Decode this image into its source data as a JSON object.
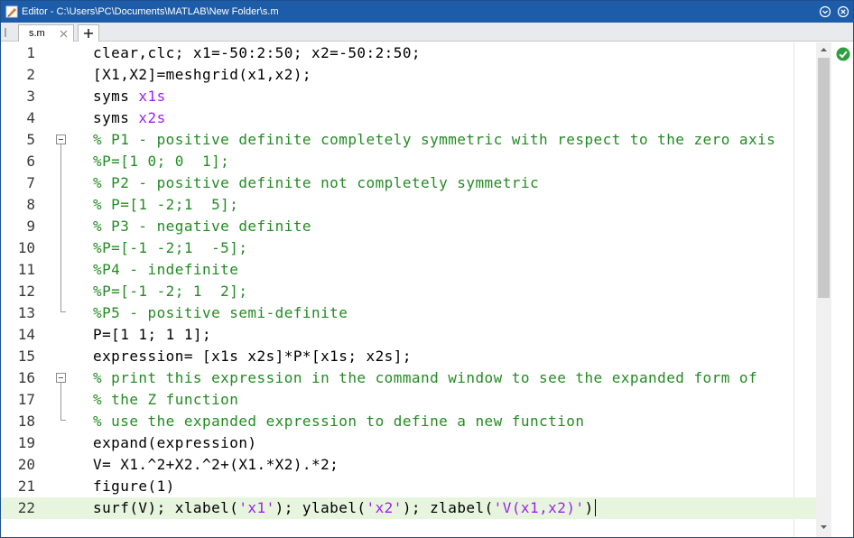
{
  "window": {
    "title": "Editor - C:\\Users\\PC\\Documents\\MATLAB\\New Folder\\s.m",
    "app_icon": "matlab-editor-icon",
    "controls": [
      "expand-icon",
      "close-icon"
    ]
  },
  "tabs": [
    {
      "label": "s.m",
      "active": true
    }
  ],
  "add_tab_icon": "plus-icon",
  "editor": {
    "current_line": 22,
    "status": "no-issues",
    "colors": {
      "comment": "#228b22",
      "symbol": "#a020f0",
      "string": "#a020f0",
      "current_line_bg": "#e7f5df",
      "title_bar": "#1d5ca8",
      "status_ok": "#2e9e3e"
    },
    "lines": [
      {
        "n": "1",
        "parts": [
          {
            "t": "clear,clc; x1=-50:2:50; x2=-50:2:50;",
            "c": "code"
          }
        ]
      },
      {
        "n": "2",
        "parts": [
          {
            "t": "[X1,X2]=meshgrid(x1,x2);",
            "c": "code"
          }
        ]
      },
      {
        "n": "3",
        "parts": [
          {
            "t": "syms ",
            "c": "code"
          },
          {
            "t": "x1s",
            "c": "sym"
          }
        ]
      },
      {
        "n": "4",
        "parts": [
          {
            "t": "syms ",
            "c": "code"
          },
          {
            "t": "x2s",
            "c": "sym"
          }
        ]
      },
      {
        "n": "5",
        "parts": [
          {
            "t": "% P1 - positive definite completely symmetric with respect to the zero axis",
            "c": "com"
          }
        ]
      },
      {
        "n": "6",
        "parts": [
          {
            "t": "%P=[1 0; 0  1];",
            "c": "com"
          }
        ]
      },
      {
        "n": "7",
        "parts": [
          {
            "t": "% P2 - positive definite not completely symmetric",
            "c": "com"
          }
        ]
      },
      {
        "n": "8",
        "parts": [
          {
            "t": "% P=[1 -2;1  5];",
            "c": "com"
          }
        ]
      },
      {
        "n": "9",
        "parts": [
          {
            "t": "% P3 - negative definite",
            "c": "com"
          }
        ]
      },
      {
        "n": "10",
        "parts": [
          {
            "t": "%P=[-1 -2;1  -5];",
            "c": "com"
          }
        ]
      },
      {
        "n": "11",
        "parts": [
          {
            "t": "%P4 - indefinite",
            "c": "com"
          }
        ]
      },
      {
        "n": "12",
        "parts": [
          {
            "t": "%P=[-1 -2; 1  2];",
            "c": "com"
          }
        ]
      },
      {
        "n": "13",
        "parts": [
          {
            "t": "%P5 - positive semi-definite",
            "c": "com"
          }
        ]
      },
      {
        "n": "14",
        "parts": [
          {
            "t": "P=[1 1; 1 1];",
            "c": "code"
          }
        ]
      },
      {
        "n": "15",
        "parts": [
          {
            "t": "expression= [x1s x2s]*P*[x1s; x2s];",
            "c": "code"
          }
        ]
      },
      {
        "n": "16",
        "parts": [
          {
            "t": "% print this expression in the command window to see the expanded form of",
            "c": "com"
          }
        ]
      },
      {
        "n": "17",
        "parts": [
          {
            "t": "% the Z function",
            "c": "com"
          }
        ]
      },
      {
        "n": "18",
        "parts": [
          {
            "t": "% use the expanded expression to define a new function",
            "c": "com"
          }
        ]
      },
      {
        "n": "19",
        "parts": [
          {
            "t": "expand(expression)",
            "c": "code"
          }
        ]
      },
      {
        "n": "20",
        "parts": [
          {
            "t": "V= X1.^2+X2.^2+(X1.*X2).*2;",
            "c": "code"
          }
        ]
      },
      {
        "n": "21",
        "parts": [
          {
            "t": "figure(1)",
            "c": "code"
          }
        ]
      },
      {
        "n": "22",
        "parts": [
          {
            "t": "surf(V); xlabel(",
            "c": "code"
          },
          {
            "t": "'x1'",
            "c": "str"
          },
          {
            "t": "); ylabel(",
            "c": "code"
          },
          {
            "t": "'x2'",
            "c": "str"
          },
          {
            "t": "); zlabel(",
            "c": "code"
          },
          {
            "t": "'V(x1,x2)'",
            "c": "str"
          },
          {
            "t": ")",
            "c": "code"
          }
        ]
      }
    ]
  }
}
